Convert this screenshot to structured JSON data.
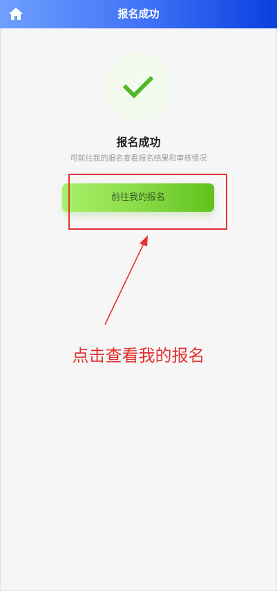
{
  "navbar": {
    "title": "报名成功",
    "home_icon": "home-icon"
  },
  "result": {
    "icon": "check-icon",
    "title": "报名成功",
    "subtitle": "可前往我的报名查看报名结果和审核情况",
    "button_label": "前往我的报名"
  },
  "annotation": {
    "text": "点击查看我的报名"
  },
  "colors": {
    "nav_gradient_start": "#6fa0ff",
    "nav_gradient_end": "#0a3fde",
    "success_green": "#52b82a",
    "button_gradient_start": "#a7f06a",
    "button_gradient_end": "#5fc21d",
    "annotation_red": "#e3302f"
  }
}
